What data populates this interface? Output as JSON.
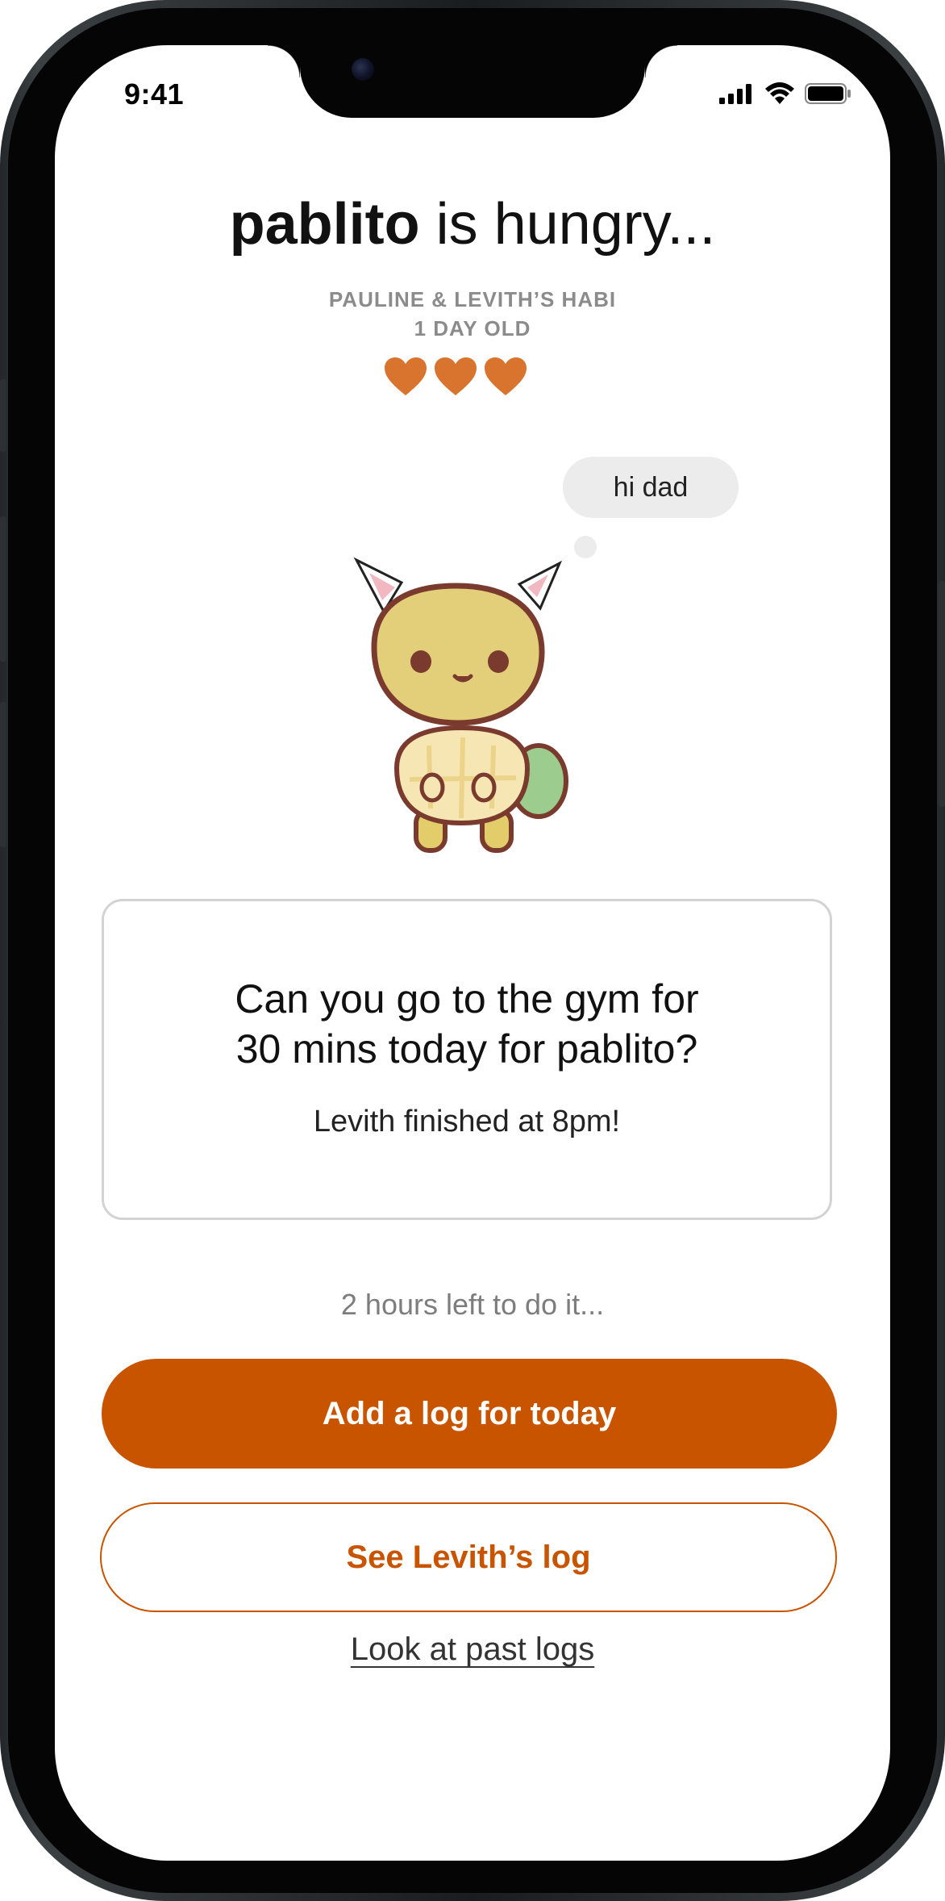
{
  "status": {
    "time": "9:41"
  },
  "header": {
    "pet_name": "pablito",
    "mood_text": " is hungry...",
    "owners": "PAULINE & LEVITH’S HABI",
    "age": "1 DAY OLD",
    "hearts": 3
  },
  "pet": {
    "speech": "hi dad",
    "icon": "turtle-cat-pet-illustration"
  },
  "task": {
    "question_line1": "Can you go to the gym for",
    "question_line2": "30 mins today for pablito?",
    "partner_status": "Levith finished at 8pm!"
  },
  "countdown": "2 hours left to do it...",
  "actions": {
    "primary": "Add a log for today",
    "secondary": "See Levith’s log",
    "link": "Look at past logs"
  },
  "colors": {
    "accent": "#c85400",
    "heart": "#d9742f",
    "muted": "#8b8b8b"
  }
}
